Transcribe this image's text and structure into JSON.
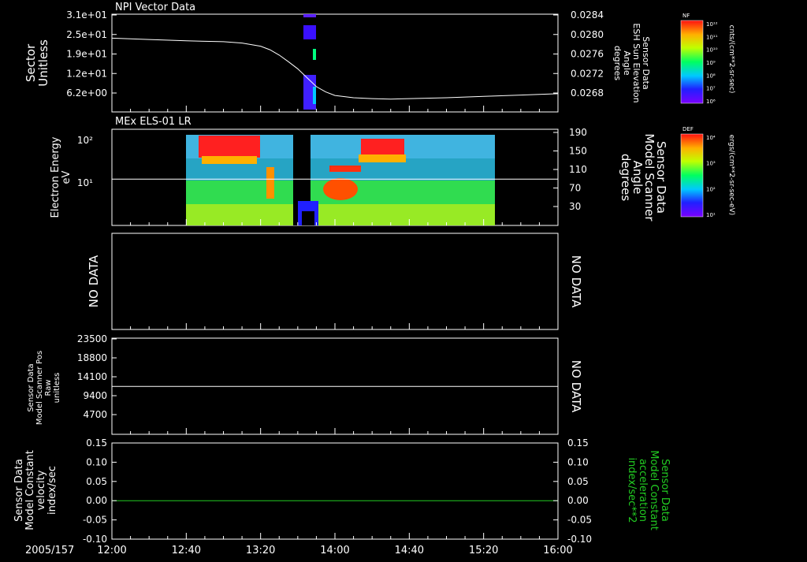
{
  "page_title": "",
  "chart_data": [
    {
      "id": "p1",
      "type": "line",
      "title": "NPI Vector Data",
      "ylabel": [
        "Sector",
        "Unitless"
      ],
      "yticks": [
        "3.1e+01",
        "2.5e+01",
        "1.9e+01",
        "1.2e+01",
        "6.2e+00"
      ],
      "y2label": [
        "Sensor Data",
        "ESH Sun Elevation",
        "Angle",
        "degrees"
      ],
      "y2ticks": [
        "0.0284",
        "0.0280",
        "0.0276",
        "0.0272",
        "0.0268"
      ],
      "series": [
        {
          "x": [
            720,
            740,
            760,
            780,
            790,
            800,
            805,
            810,
            815,
            820,
            825,
            830,
            835,
            840,
            850,
            860,
            870,
            880,
            900,
            920,
            940,
            960
          ],
          "y": [
            0.02806,
            0.02803,
            0.028,
            0.02798,
            0.02795,
            0.02788,
            0.0278,
            0.02768,
            0.02753,
            0.02737,
            0.02717,
            0.02697,
            0.02685,
            0.02677,
            0.02672,
            0.0267,
            0.02669,
            0.0267,
            0.02672,
            0.02675,
            0.02678,
            0.02681
          ]
        }
      ],
      "y2lim": [
        0.0264,
        0.0286
      ],
      "colorbar": {
        "label": "NF",
        "unit": "cnts/(cm**2-sr-sec)",
        "ticks": [
          "10¹²",
          "10¹¹",
          "10¹⁰",
          "10⁹",
          "10⁸",
          "10⁷",
          "10⁶"
        ]
      }
    },
    {
      "id": "p2",
      "type": "heatmap",
      "title": "MEx ELS-01 LR",
      "ylabel": [
        "Electron Energy",
        "eV"
      ],
      "yticks": [
        "10²",
        "10¹"
      ],
      "y2label": [
        "Sensor Data",
        "Model Scanner",
        "Angle",
        "degrees"
      ],
      "y2ticks": [
        "190",
        "150",
        "110",
        "70",
        "30"
      ],
      "y2lim": [
        0,
        190
      ],
      "line_y2": 93,
      "colorbar": {
        "label": "DEF",
        "unit": "ergs/(cm**2-sr-sec-eV)",
        "ticks": [
          "10⁴",
          "10³",
          "10²",
          "10¹"
        ]
      }
    },
    {
      "id": "p3",
      "type": "line",
      "left_text": "NO DATA",
      "right_text": "NO DATA"
    },
    {
      "id": "p4",
      "type": "line",
      "ylabel": [
        "Sensor Data",
        "Model Scanner Pos",
        "Raw",
        "unitless"
      ],
      "yticks": [
        "23500",
        "18800",
        "14100",
        "9400",
        "4700"
      ],
      "ylim": [
        0,
        23500
      ],
      "series": [
        {
          "x": [
            720,
            960
          ],
          "y": [
            11700,
            11700
          ]
        }
      ],
      "right_text": "NO DATA"
    },
    {
      "id": "p5",
      "type": "line",
      "ylabel": [
        "Sensor Data",
        "Model Constant",
        "velocity",
        "index/sec"
      ],
      "yticks": [
        "0.15",
        "0.10",
        "0.05",
        "0.00",
        "-0.05",
        "-0.10"
      ],
      "y2label": [
        "Sensor Data",
        "Model Constant",
        "acceleration",
        "index/sec**2"
      ],
      "y2ticks": [
        "0.15",
        "0.10",
        "0.05",
        "0.00",
        "-0.05",
        "-0.10"
      ],
      "ylim": [
        -0.1,
        0.15
      ],
      "series": [
        {
          "x": [
            720,
            960
          ],
          "y": [
            0,
            0
          ],
          "color": "#22cc22"
        }
      ]
    }
  ],
  "xaxis": {
    "date": "2005/157",
    "ticks": [
      "12:00",
      "12:40",
      "13:20",
      "14:00",
      "14:40",
      "15:20",
      "16:00"
    ],
    "range": [
      "12:00",
      "16:00"
    ]
  },
  "colors": {
    "frame": "#ffffff",
    "accent_green": "#22cc22"
  }
}
